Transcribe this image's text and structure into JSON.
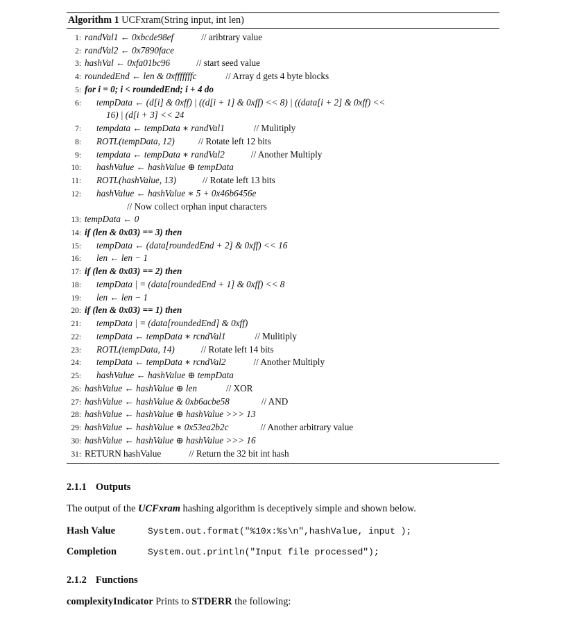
{
  "algorithm": {
    "label": "Algorithm 1",
    "signature": "UCFxram(String input, int len)",
    "lines": [
      {
        "num": "1:",
        "indent": 0,
        "text": "randVal1 ← 0xbcde98ef",
        "comment": "// aribtrary value"
      },
      {
        "num": "2:",
        "indent": 0,
        "text": "randVal2 ← 0x7890face",
        "comment": ""
      },
      {
        "num": "3:",
        "indent": 0,
        "text": "hashVal ← 0xfa01bc96",
        "comment": "// start seed value"
      },
      {
        "num": "4:",
        "indent": 0,
        "text": "roundedEnd ← len & 0xfffffffc",
        "comment": "// Array d gets 4 byte blocks"
      },
      {
        "num": "5:",
        "indent": 0,
        "text": "for i = 0; i < roundedEnd; i + 4 do",
        "comment": ""
      },
      {
        "num": "6:",
        "indent": 1,
        "text": "tempData ← (d[i] & 0xff) | ((d[i + 1] & 0xff)  <<  8) | ((data[i + 2] & 0xff) << 16) | (d[i + 3]  <<  24",
        "comment": ""
      },
      {
        "num": "7:",
        "indent": 1,
        "text": "tempdata ← tempData ∗ randVal1",
        "comment": "// Mulitiply"
      },
      {
        "num": "8:",
        "indent": 1,
        "text": "ROTL(tempData, 12)",
        "comment": "// Rotate left 12 bits"
      },
      {
        "num": "9:",
        "indent": 1,
        "text": "tempdata ← tempData ∗ randVal2",
        "comment": "// Another Multiply"
      },
      {
        "num": "10:",
        "indent": 1,
        "text": "hashValue ← hashValue ⊕ tempData",
        "comment": ""
      },
      {
        "num": "11:",
        "indent": 1,
        "text": "ROTL(hashValue, 13)",
        "comment": "// Rotate left 13 bits"
      },
      {
        "num": "12:",
        "indent": 1,
        "text": "hashValue ← hashValue ∗ 5 + 0x46b6456e",
        "comment": ""
      },
      {
        "num": "",
        "indent": 2,
        "text": "",
        "comment": "// Now collect orphan input characters"
      },
      {
        "num": "13:",
        "indent": 0,
        "text": "tempData ← 0",
        "comment": ""
      },
      {
        "num": "14:",
        "indent": 0,
        "text": "if (len & 0x03) == 3) then",
        "comment": ""
      },
      {
        "num": "15:",
        "indent": 1,
        "text": "tempData ← (data[roundedEnd + 2] & 0xff) << 16",
        "comment": ""
      },
      {
        "num": "16:",
        "indent": 1,
        "text": "len ← len − 1",
        "comment": ""
      },
      {
        "num": "17:",
        "indent": 0,
        "text": "if (len & 0x03) == 2) then",
        "comment": ""
      },
      {
        "num": "18:",
        "indent": 1,
        "text": "tempData | = (data[roundedEnd + 1] & 0xff) << 8",
        "comment": ""
      },
      {
        "num": "19:",
        "indent": 1,
        "text": "len ← len − 1",
        "comment": ""
      },
      {
        "num": "20:",
        "indent": 0,
        "text": "if (len & 0x03)  ==  1) then",
        "comment": ""
      },
      {
        "num": "21:",
        "indent": 1,
        "text": "tempData | = (data[roundedEnd] & 0xff)",
        "comment": ""
      },
      {
        "num": "22:",
        "indent": 1,
        "text": "tempData ← tempData ∗ rcndVal1",
        "comment": "// Mulitiply"
      },
      {
        "num": "23:",
        "indent": 1,
        "text": "ROTL(tempData, 14)",
        "comment": "// Rotate left 14 bits"
      },
      {
        "num": "24:",
        "indent": 1,
        "text": "tempData ← tempData ∗ rcndVal2",
        "comment": "// Another Multiply"
      },
      {
        "num": "25:",
        "indent": 1,
        "text": "hashValue ← hashValue ⊕ tempData",
        "comment": ""
      },
      {
        "num": "26:",
        "indent": 0,
        "text": "hashValue ← hashValue ⊕ len",
        "comment": "// XOR"
      },
      {
        "num": "27:",
        "indent": 0,
        "text": "hashValue ← hashValue & 0xb6acbe58",
        "comment": "// AND"
      },
      {
        "num": "28:",
        "indent": 0,
        "text": "hashValue ← hashValue ⊕ hashValue >>> 13",
        "comment": ""
      },
      {
        "num": "29:",
        "indent": 0,
        "text": "hashValue ← hashValue ∗ 0x53ea2b2c",
        "comment": "// Another arbitrary value"
      },
      {
        "num": "30:",
        "indent": 0,
        "text": "hashValue ← hashValue ⊕ hashValue >>> 16",
        "comment": ""
      },
      {
        "num": "31:",
        "indent": 0,
        "text": "RETURN hashValue",
        "comment": "// Return the 32 bit int hash"
      }
    ],
    "line6": {
      "num": "6:",
      "part1": "tempData ← (d[i] & 0xff) | ((d[i + 1] & 0xff)  <<  8) | ((data[i + 2] & 0xff) <<",
      "part2": "16) | (d[i + 3]  <<  24"
    },
    "line12_comment": "// Now collect orphan input characters"
  },
  "outputs_section": {
    "number": "2.1.1",
    "title": "Outputs",
    "paragraph_pre": "The output of the ",
    "paragraph_emph": "UCFxram",
    "paragraph_post": " hashing algorithm is deceptively simple and shown below.",
    "rows": [
      {
        "term": "Hash Value",
        "code": "System.out.format(\"%10x:%s\\n\",hashValue, input );"
      },
      {
        "term": "Completion",
        "code": "System.out.println(\"Input file processed\");"
      }
    ]
  },
  "functions_section": {
    "number": "2.1.2",
    "title": "Functions",
    "func_name": "complexityIndicator",
    "func_pre": " Prints to ",
    "func_emph": "STDERR",
    "func_post": " the following:"
  }
}
